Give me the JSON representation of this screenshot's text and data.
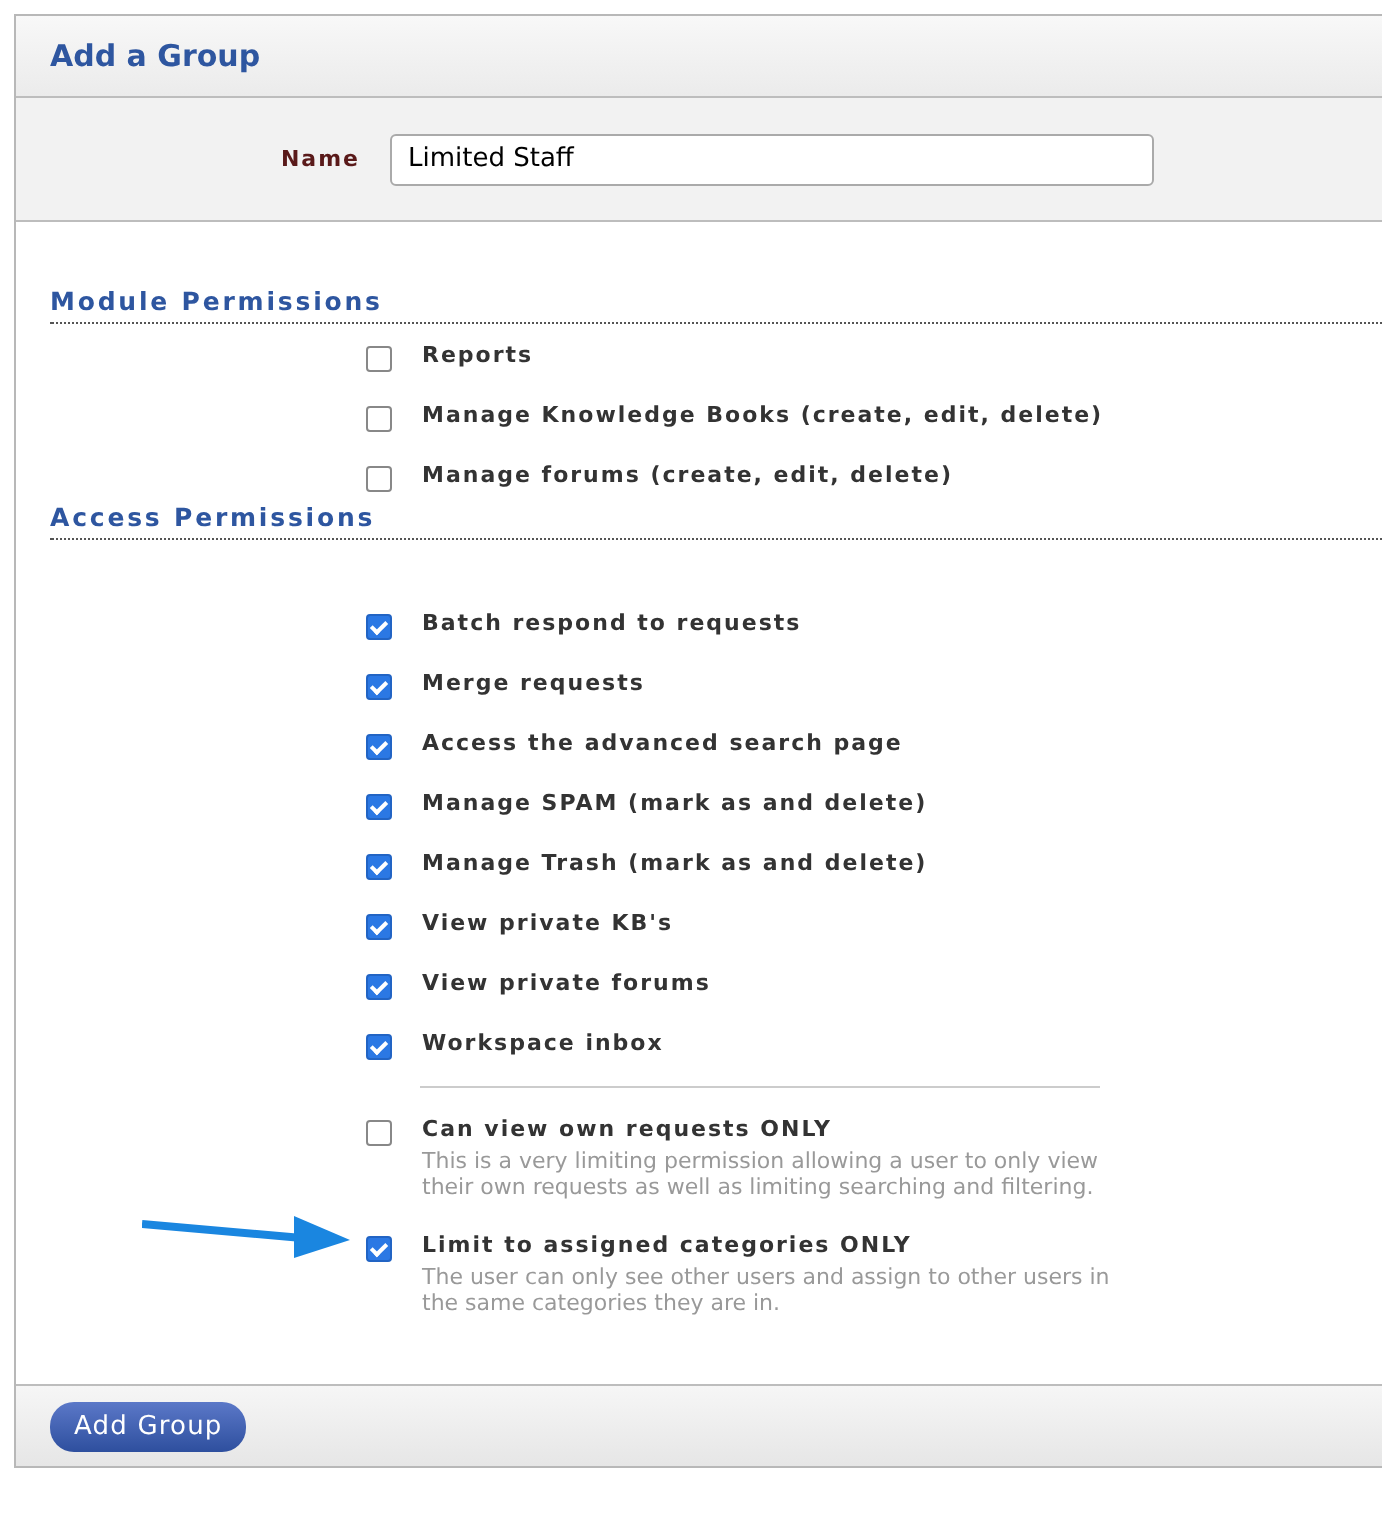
{
  "title": "Add a Group",
  "name_field": {
    "label": "Name",
    "value": "Limited Staff"
  },
  "sections": [
    {
      "title": "Module Permissions",
      "items": [
        {
          "label": "Reports",
          "checked": false
        },
        {
          "label": "Manage Knowledge Books (create, edit, delete)",
          "checked": false
        },
        {
          "label": "Manage forums (create, edit, delete)",
          "checked": false
        }
      ]
    },
    {
      "title": "Access Permissions",
      "items": [
        {
          "label": "Batch respond to requests",
          "checked": true
        },
        {
          "label": "Merge requests",
          "checked": true
        },
        {
          "label": "Access the advanced search page",
          "checked": true
        },
        {
          "label": "Manage SPAM (mark as and delete)",
          "checked": true
        },
        {
          "label": "Manage Trash (mark as and delete)",
          "checked": true
        },
        {
          "label": "View private KB's",
          "checked": true
        },
        {
          "label": "View private forums",
          "checked": true
        },
        {
          "label": "Workspace inbox",
          "checked": true
        }
      ],
      "restrictions": [
        {
          "label": "Can view own requests ONLY",
          "checked": false,
          "description": "This is a very limiting permission allowing a user to only view their own requests as well as limiting searching and filtering."
        },
        {
          "label": "Limit to assigned categories ONLY",
          "checked": true,
          "description": "The user can only see other users and assign to other users in the same categories they are in."
        }
      ]
    }
  ],
  "submit": "Add Group"
}
